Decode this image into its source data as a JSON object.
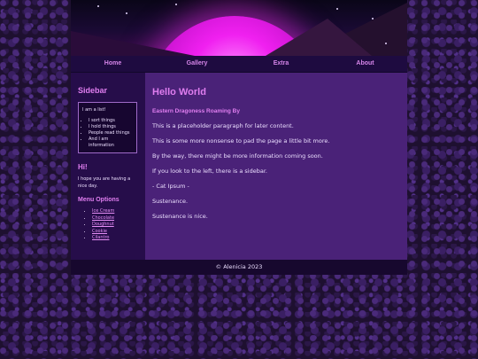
{
  "nav": {
    "items": [
      {
        "label": "Home"
      },
      {
        "label": "Gallery"
      },
      {
        "label": "Extra"
      },
      {
        "label": "About"
      }
    ]
  },
  "sidebar": {
    "title": "Sidebar",
    "box_intro": "I am a list!",
    "box_items": [
      {
        "text": "I sort things"
      },
      {
        "text": "I hold things"
      },
      {
        "text": "People read things"
      },
      {
        "text": "And I am information"
      }
    ],
    "hi_title": "Hi!",
    "hi_text": "I hope you are having a nice day.",
    "menu_title": "Menu Options",
    "menu_items": [
      {
        "label": "Ice Cream"
      },
      {
        "label": "Chocolate"
      },
      {
        "label": "Doughnut"
      },
      {
        "label": "Cookie"
      },
      {
        "label": "Cilantro"
      }
    ]
  },
  "main": {
    "title": "Hello World",
    "subtitle": "Eastern Dragoness Roaming By",
    "paragraphs": [
      "This is a placeholder paragraph for later content.",
      "This is some more nonsense to pad the page a little bit more.",
      "By the way, there might be more information coming soon.",
      "If you look to the left, there is a sidebar.",
      "- Cat Ipsum -",
      "Sustenance.",
      "Sustenance is nice."
    ]
  },
  "footer": {
    "text": "© Alenicia 2023"
  },
  "colors": {
    "accent": "#e07ef0",
    "main_bg": "#4a2278",
    "sidebar_bg": "#260d4a",
    "nav_bg": "#1e0b40"
  }
}
